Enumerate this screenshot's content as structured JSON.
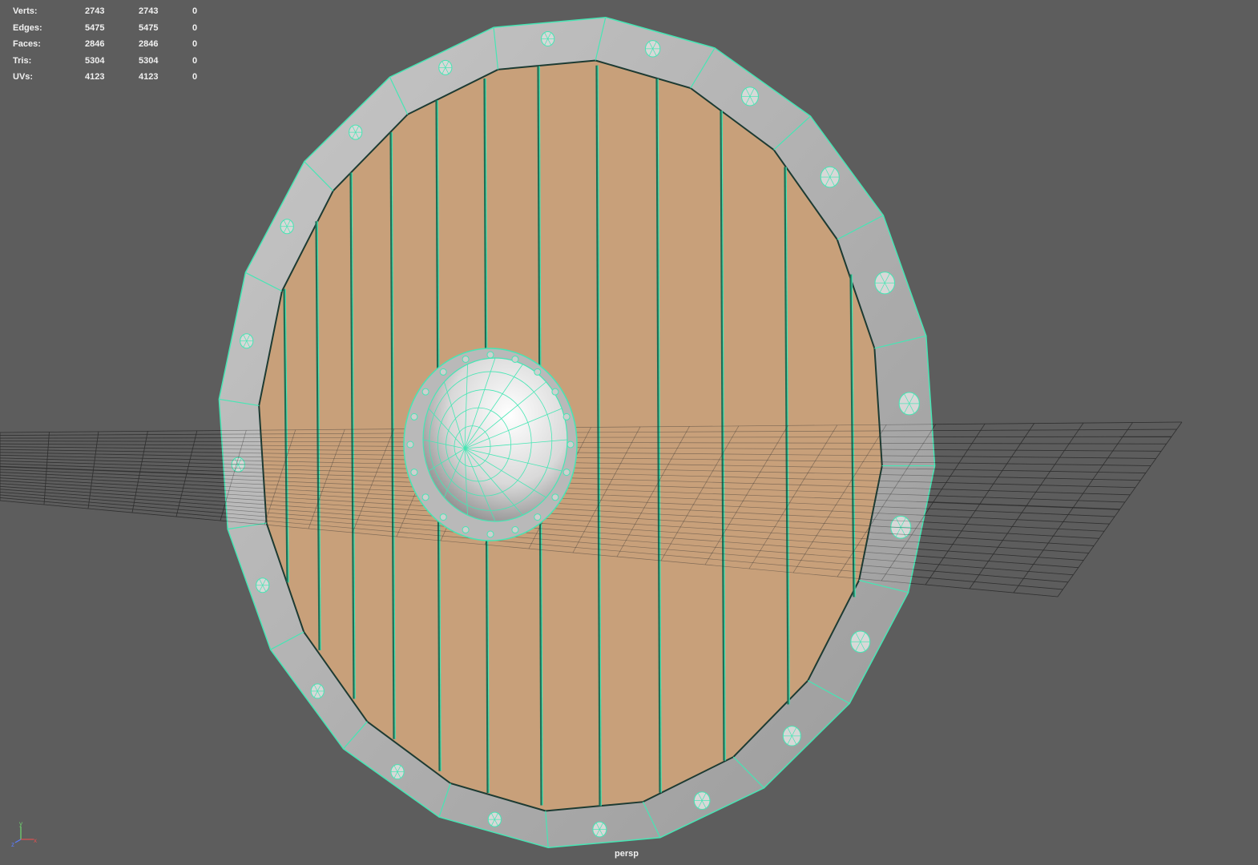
{
  "hud": {
    "rows": [
      {
        "label": "Verts:",
        "total": "2743",
        "selected": "2743",
        "extra": "0"
      },
      {
        "label": "Edges:",
        "total": "5475",
        "selected": "5475",
        "extra": "0"
      },
      {
        "label": "Faces:",
        "total": "2846",
        "selected": "2846",
        "extra": "0"
      },
      {
        "label": "Tris:",
        "total": "5304",
        "selected": "5304",
        "extra": "0"
      },
      {
        "label": "UVs:",
        "total": "4123",
        "selected": "4123",
        "extra": "0"
      }
    ]
  },
  "viewport": {
    "camera": "persp",
    "background_color": "#5d5d5d",
    "wire_color": "#46e6b4",
    "wood_color": "#c8a07a",
    "rim_color": "#bdbdbd",
    "grid_color": "#2e2e2e"
  },
  "axis_gizmo": {
    "x": "x",
    "y": "y",
    "z": "z"
  },
  "scene_object": {
    "name": "round shield",
    "icons": [
      "shield-mesh-icon",
      "boss-sphere-icon",
      "rivet-icon"
    ]
  }
}
